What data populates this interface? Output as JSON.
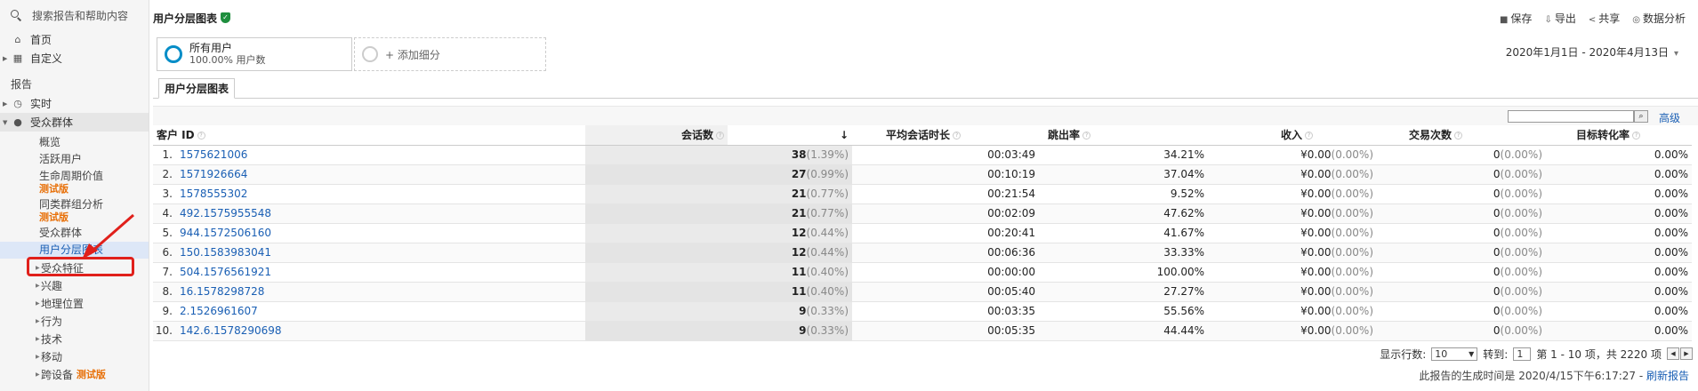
{
  "sidebar": {
    "search_placeholder": "搜索报告和帮助内容",
    "home": "首页",
    "custom": "自定义",
    "section_reports": "报告",
    "realtime": "实时",
    "audience": "受众群体",
    "audience_items": {
      "overview": "概览",
      "active_users": "活跃用户",
      "lifetime_value": "生命周期价值",
      "cohort": "同类群组分析",
      "beta": "测试版",
      "audiences": "受众群体",
      "user_explorer": "用户分层图表"
    },
    "audience_children": [
      "受众特征",
      "兴趣",
      "地理位置",
      "行为",
      "技术",
      "移动",
      "跨设备"
    ],
    "cross_device_beta": "测试版"
  },
  "header": {
    "title": "用户分层图表",
    "actions": [
      "保存",
      "导出",
      "共享",
      "数据分析"
    ]
  },
  "segments": {
    "all_users": "所有用户",
    "all_users_sub": "100.00% 用户数",
    "add_segment": "+ 添加细分"
  },
  "date_range": "2020年1月1日 - 2020年4月13日",
  "tab": "用户分层图表",
  "filter": {
    "advanced": "高级"
  },
  "table": {
    "headers": [
      "客户 ID",
      "会话数",
      "平均会话时长",
      "跳出率",
      "收入",
      "交易次数",
      "目标转化率"
    ],
    "sort_arrow": "↓",
    "rows": [
      {
        "idx": "1.",
        "id": "1575621006",
        "sessions": "38",
        "spct": "(1.39%)",
        "dur": "00:03:49",
        "bounce": "34.21%",
        "rev": "¥0.00",
        "revpct": "(0.00%)",
        "tx": "0",
        "txpct": "(0.00%)",
        "goal": "0.00%"
      },
      {
        "idx": "2.",
        "id": "1571926664",
        "sessions": "27",
        "spct": "(0.99%)",
        "dur": "00:10:19",
        "bounce": "37.04%",
        "rev": "¥0.00",
        "revpct": "(0.00%)",
        "tx": "0",
        "txpct": "(0.00%)",
        "goal": "0.00%"
      },
      {
        "idx": "3.",
        "id": "1578555302",
        "sessions": "21",
        "spct": "(0.77%)",
        "dur": "00:21:54",
        "bounce": "9.52%",
        "rev": "¥0.00",
        "revpct": "(0.00%)",
        "tx": "0",
        "txpct": "(0.00%)",
        "goal": "0.00%"
      },
      {
        "idx": "4.",
        "id": "492.1575955548",
        "sessions": "21",
        "spct": "(0.77%)",
        "dur": "00:02:09",
        "bounce": "47.62%",
        "rev": "¥0.00",
        "revpct": "(0.00%)",
        "tx": "0",
        "txpct": "(0.00%)",
        "goal": "0.00%"
      },
      {
        "idx": "5.",
        "id": "944.1572506160",
        "sessions": "12",
        "spct": "(0.44%)",
        "dur": "00:20:41",
        "bounce": "41.67%",
        "rev": "¥0.00",
        "revpct": "(0.00%)",
        "tx": "0",
        "txpct": "(0.00%)",
        "goal": "0.00%"
      },
      {
        "idx": "6.",
        "id": "150.1583983041",
        "sessions": "12",
        "spct": "(0.44%)",
        "dur": "00:06:36",
        "bounce": "33.33%",
        "rev": "¥0.00",
        "revpct": "(0.00%)",
        "tx": "0",
        "txpct": "(0.00%)",
        "goal": "0.00%"
      },
      {
        "idx": "7.",
        "id": "504.1576561921",
        "sessions": "11",
        "spct": "(0.40%)",
        "dur": "00:00:00",
        "bounce": "100.00%",
        "rev": "¥0.00",
        "revpct": "(0.00%)",
        "tx": "0",
        "txpct": "(0.00%)",
        "goal": "0.00%"
      },
      {
        "idx": "8.",
        "id": "16.1578298728",
        "sessions": "11",
        "spct": "(0.40%)",
        "dur": "00:05:40",
        "bounce": "27.27%",
        "rev": "¥0.00",
        "revpct": "(0.00%)",
        "tx": "0",
        "txpct": "(0.00%)",
        "goal": "0.00%"
      },
      {
        "idx": "9.",
        "id": "2.1526961607",
        "sessions": "9",
        "spct": "(0.33%)",
        "dur": "00:03:35",
        "bounce": "55.56%",
        "rev": "¥0.00",
        "revpct": "(0.00%)",
        "tx": "0",
        "txpct": "(0.00%)",
        "goal": "0.00%"
      },
      {
        "idx": "10.",
        "id": "142.6.1578290698",
        "sessions": "9",
        "spct": "(0.33%)",
        "dur": "00:05:35",
        "bounce": "44.44%",
        "rev": "¥0.00",
        "revpct": "(0.00%)",
        "tx": "0",
        "txpct": "(0.00%)",
        "goal": "0.00%"
      }
    ]
  },
  "pager": {
    "rows_label": "显示行数:",
    "rows_value": "10",
    "goto_label": "转到:",
    "goto_value": "1",
    "range_text": "第 1 - 10 项，共 2220 项"
  },
  "footer": {
    "generated": "此报告的生成时间是 2020/4/15下午6:17:27 -",
    "refresh": "刷新报告"
  },
  "colors": {
    "accent": "#058dc7",
    "link": "#1a5fb4",
    "highlight": "#e0201b",
    "beta": "#e8710a"
  }
}
